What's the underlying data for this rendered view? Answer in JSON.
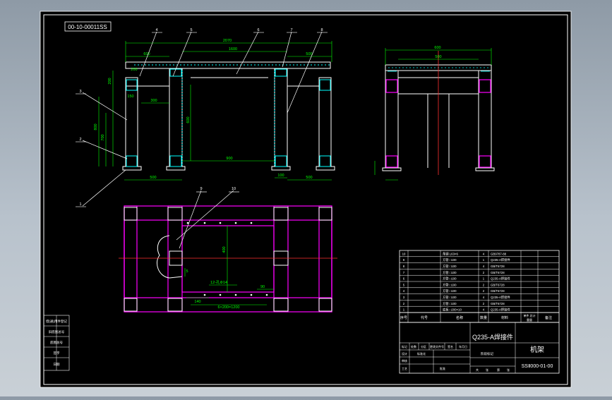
{
  "drawing": {
    "code_tag": "00-10-00011SS",
    "title_block": {
      "material": "Q235-A焊接件",
      "part_name": "机架",
      "drawing_number": "SSⅡ000-01-00",
      "header": {
        "seq": "序号",
        "code": "代号",
        "name": "名称",
        "qty": "数量",
        "material": "材料",
        "unit_total": "单件 总计",
        "weight": "重量",
        "remark": "备注"
      },
      "revision_row": [
        "标记",
        "处数",
        "分区",
        "更改文件号",
        "签名",
        "年月日"
      ],
      "stage": "阶段标记",
      "sign_rows": [
        "设计",
        "审核",
        "工艺",
        "标准化",
        "批准"
      ],
      "sheet_labels": [
        "共",
        "张",
        "第",
        "张"
      ]
    },
    "parts_list": [
      {
        "no": "10",
        "spec": "角钢 L63×6",
        "qty": "4",
        "std": "GB9787-88"
      },
      {
        "no": "9",
        "spec": "方管 □100",
        "qty": "1",
        "std": "Q235-A焊接件"
      },
      {
        "no": "8",
        "spec": "方管 □100",
        "qty": "4",
        "std": "GB/T6728"
      },
      {
        "no": "7",
        "spec": "方管 □100",
        "qty": "2",
        "std": "GB/T6728"
      },
      {
        "no": "6",
        "spec": "方管 □100",
        "qty": "1",
        "std": "Q235-A焊接件"
      },
      {
        "no": "5",
        "spec": "方管 □100",
        "qty": "2",
        "std": "GB/T6728"
      },
      {
        "no": "4",
        "spec": "方管 □100",
        "qty": "2",
        "std": "GB/T6728"
      },
      {
        "no": "3",
        "spec": "方管 □100",
        "qty": "4",
        "std": "Q235-A焊接件"
      },
      {
        "no": "2",
        "spec": "方管 □100",
        "qty": "2",
        "std": "GB/T6728"
      },
      {
        "no": "1",
        "spec": "底板 □200×10",
        "qty": "4",
        "std": "Q235-A焊接件"
      }
    ],
    "left_stamp": [
      "借(通)用件登记",
      "旧底图总号",
      "底图总号",
      "签字",
      "日期"
    ],
    "balloons": {
      "front_top": [
        "4",
        "5",
        "6",
        "7",
        "8"
      ],
      "front_left": [
        "3",
        "2",
        "1"
      ],
      "plan": [
        "9",
        "10"
      ]
    },
    "dims": {
      "overall": "2070",
      "front_upper": [
        "1600",
        "600",
        "500"
      ],
      "front_lower": [
        "500",
        "900",
        "100",
        "500"
      ],
      "front_vertical": [
        "800",
        "700",
        "200"
      ],
      "front_inner": [
        "300",
        "150",
        "600",
        "200"
      ],
      "side_top": [
        "600",
        "500"
      ],
      "plan": [
        "400",
        "12-孔Φ14",
        "140",
        "6×200=1200",
        "90",
        "5"
      ]
    },
    "colors": {
      "sheet": "#000000",
      "border": "#ffffff",
      "outline": "#ffffff",
      "dimension": "#00ff00",
      "hatch": "#00ffff",
      "center": "#ff3030",
      "hidden": "#ff00ff"
    }
  }
}
